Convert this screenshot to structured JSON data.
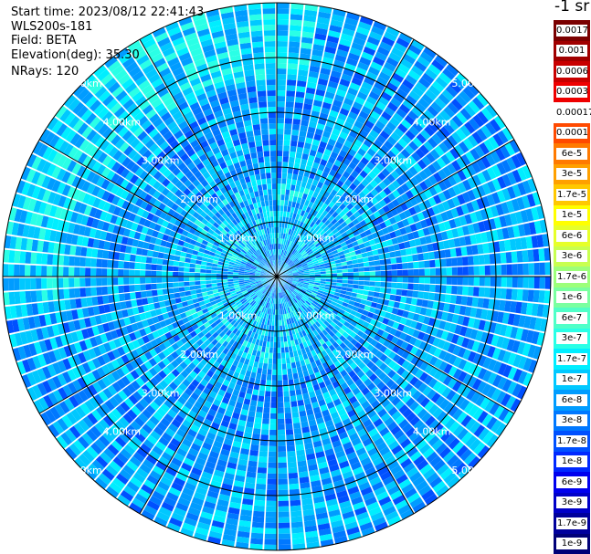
{
  "info": {
    "start_time": "Start time: 2023/08/12 22:41:43",
    "station": "WLS200s-181",
    "field": "Field: BETA",
    "elevation": "Elevation(deg): 35.30",
    "nrays": "NRays: 120"
  },
  "chart_data": {
    "type": "heatmap",
    "projection": "polar (PPI scan)",
    "field": "BETA",
    "n_rays": 120,
    "elevation_deg": 35.3,
    "range_km": [
      0,
      5.0
    ],
    "range_ring_labels": [
      "1.00km",
      "2.00km",
      "3.00km",
      "4.00km",
      "5.00km"
    ],
    "range_rings_km": [
      1,
      2,
      3,
      4,
      5
    ],
    "spoke_angles_deg": [
      0,
      30,
      60,
      90,
      120,
      150,
      180,
      210,
      240,
      270,
      300,
      330
    ],
    "colorbar": {
      "unit_label": "-1 sr",
      "labels": [
        "0.0017",
        "0.001",
        "0.0006",
        "0.0003",
        "0.00017",
        "0.0001",
        "6e-5",
        "3e-5",
        "1.7e-5",
        "1e-5",
        "6e-6",
        "3e-6",
        "1.7e-6",
        "1e-6",
        "6e-7",
        "3e-7",
        "1.7e-7",
        "1e-7",
        "6e-8",
        "3e-8",
        "1.7e-8",
        "1e-8",
        "6e-9",
        "3e-9",
        "1.7e-9",
        "1e-9"
      ],
      "colors": [
        "#7a0000",
        "#a00000",
        "#c80000",
        "#ee0000",
        "#ffffff",
        "#ff4a00",
        "#ff7a00",
        "#ffa000",
        "#ffc800",
        "#ffff00",
        "#e6ff2a",
        "#c8ff50",
        "#9cff7a",
        "#7affa0",
        "#50ffc8",
        "#2affe6",
        "#00eeff",
        "#00c8ff",
        "#009cff",
        "#0078ff",
        "#0050ff",
        "#0028ff",
        "#0000ee",
        "#0000c8",
        "#00009c",
        "#000078"
      ]
    },
    "grid": true
  }
}
